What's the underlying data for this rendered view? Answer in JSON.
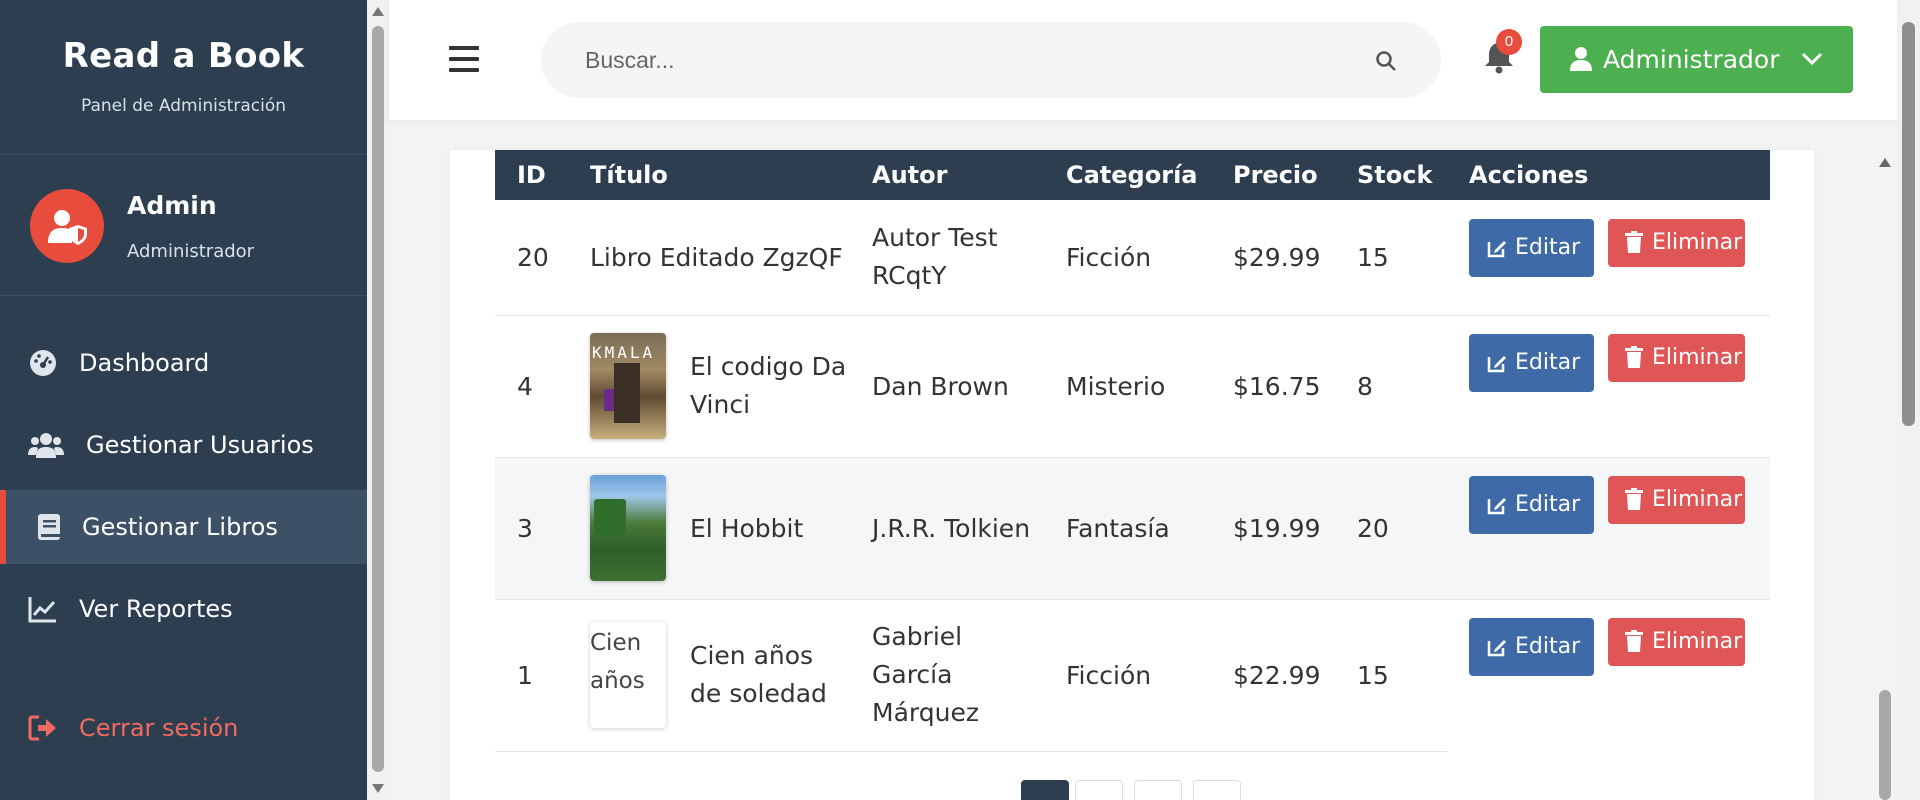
{
  "sidebar": {
    "brand_title": "Read a Book",
    "brand_subtitle": "Panel de Administración",
    "user_name": "Admin",
    "user_role": "Administrador",
    "nav": [
      {
        "label": "Dashboard",
        "icon": "tachometer-icon"
      },
      {
        "label": "Gestionar Usuarios",
        "icon": "users-icon"
      },
      {
        "label": "Gestionar Libros",
        "icon": "book-icon",
        "active": true
      },
      {
        "label": "Ver Reportes",
        "icon": "chart-line-icon"
      }
    ],
    "logout_label": "Cerrar sesión"
  },
  "header": {
    "search_placeholder": "Buscar...",
    "notification_count": "0",
    "admin_label": "Administrador"
  },
  "table": {
    "columns": [
      "ID",
      "Título",
      "Autor",
      "Categoría",
      "Precio",
      "Stock",
      "Acciones"
    ],
    "rows": [
      {
        "id": "20",
        "title": "Libro Editado ZgzQF",
        "author": "Autor Test RCqtY",
        "category": "Ficción",
        "price": "$29.99",
        "stock": "15",
        "cover": "none"
      },
      {
        "id": "4",
        "title": "El codigo Da Vinci",
        "author": "Dan Brown",
        "category": "Misterio",
        "price": "$16.75",
        "stock": "8",
        "cover": "image"
      },
      {
        "id": "3",
        "title": "El Hobbit",
        "author": "J.R.R. Tolkien",
        "category": "Fantasía",
        "price": "$19.99",
        "stock": "20",
        "cover": "image"
      },
      {
        "id": "1",
        "title": "Cien años de soledad",
        "author": "Gabriel García Márquez",
        "category": "Ficción",
        "price": "$22.99",
        "stock": "15",
        "cover": "broken",
        "cover_alt": "Cien años"
      }
    ],
    "edit_label": "Editar",
    "delete_label": "Eliminar"
  },
  "cover_text": "KMALA",
  "colors": {
    "sidebar_bg": "#2c3e50",
    "accent_red": "#e74c3c",
    "admin_green": "#4caf50",
    "edit_blue": "#3e6aa8",
    "delete_red": "#e05555"
  }
}
